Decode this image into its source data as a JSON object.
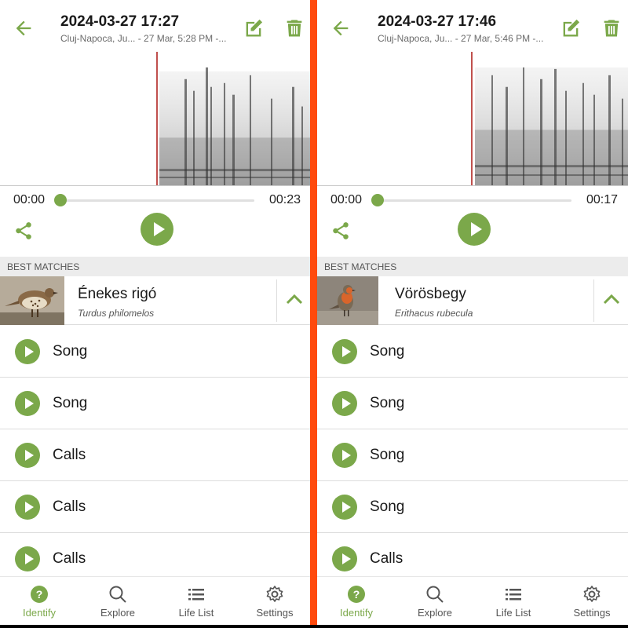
{
  "panels": [
    {
      "header": {
        "title": "2024-03-27 17:27",
        "subtitle": "Cluj-Napoca, Ju... - 27 Mar, 5:28 PM -..."
      },
      "player": {
        "time_start": "00:00",
        "time_end": "00:23",
        "progress": 0
      },
      "section_title": "BEST MATCHES",
      "match": {
        "common_name": "Énekes rigó",
        "scientific_name": "Turdus philomelos"
      },
      "sounds": [
        "Song",
        "Song",
        "Calls",
        "Calls",
        "Calls"
      ]
    },
    {
      "header": {
        "title": "2024-03-27 17:46",
        "subtitle": "Cluj-Napoca, Ju... - 27 Mar, 5:46 PM -..."
      },
      "player": {
        "time_start": "00:00",
        "time_end": "00:17",
        "progress": 0
      },
      "section_title": "BEST MATCHES",
      "match": {
        "common_name": "Vörösbegy",
        "scientific_name": "Erithacus rubecula"
      },
      "sounds": [
        "Song",
        "Song",
        "Song",
        "Song",
        "Calls"
      ]
    }
  ],
  "nav": {
    "items": [
      {
        "label": "Identify",
        "icon": "help-circle-icon",
        "active": true
      },
      {
        "label": "Explore",
        "icon": "search-icon",
        "active": false
      },
      {
        "label": "Life List",
        "icon": "list-icon",
        "active": false
      },
      {
        "label": "Settings",
        "icon": "gear-icon",
        "active": false
      }
    ]
  },
  "colors": {
    "accent": "#7ba84a",
    "divider": "#ff4a0d",
    "playhead": "#c0504d"
  }
}
